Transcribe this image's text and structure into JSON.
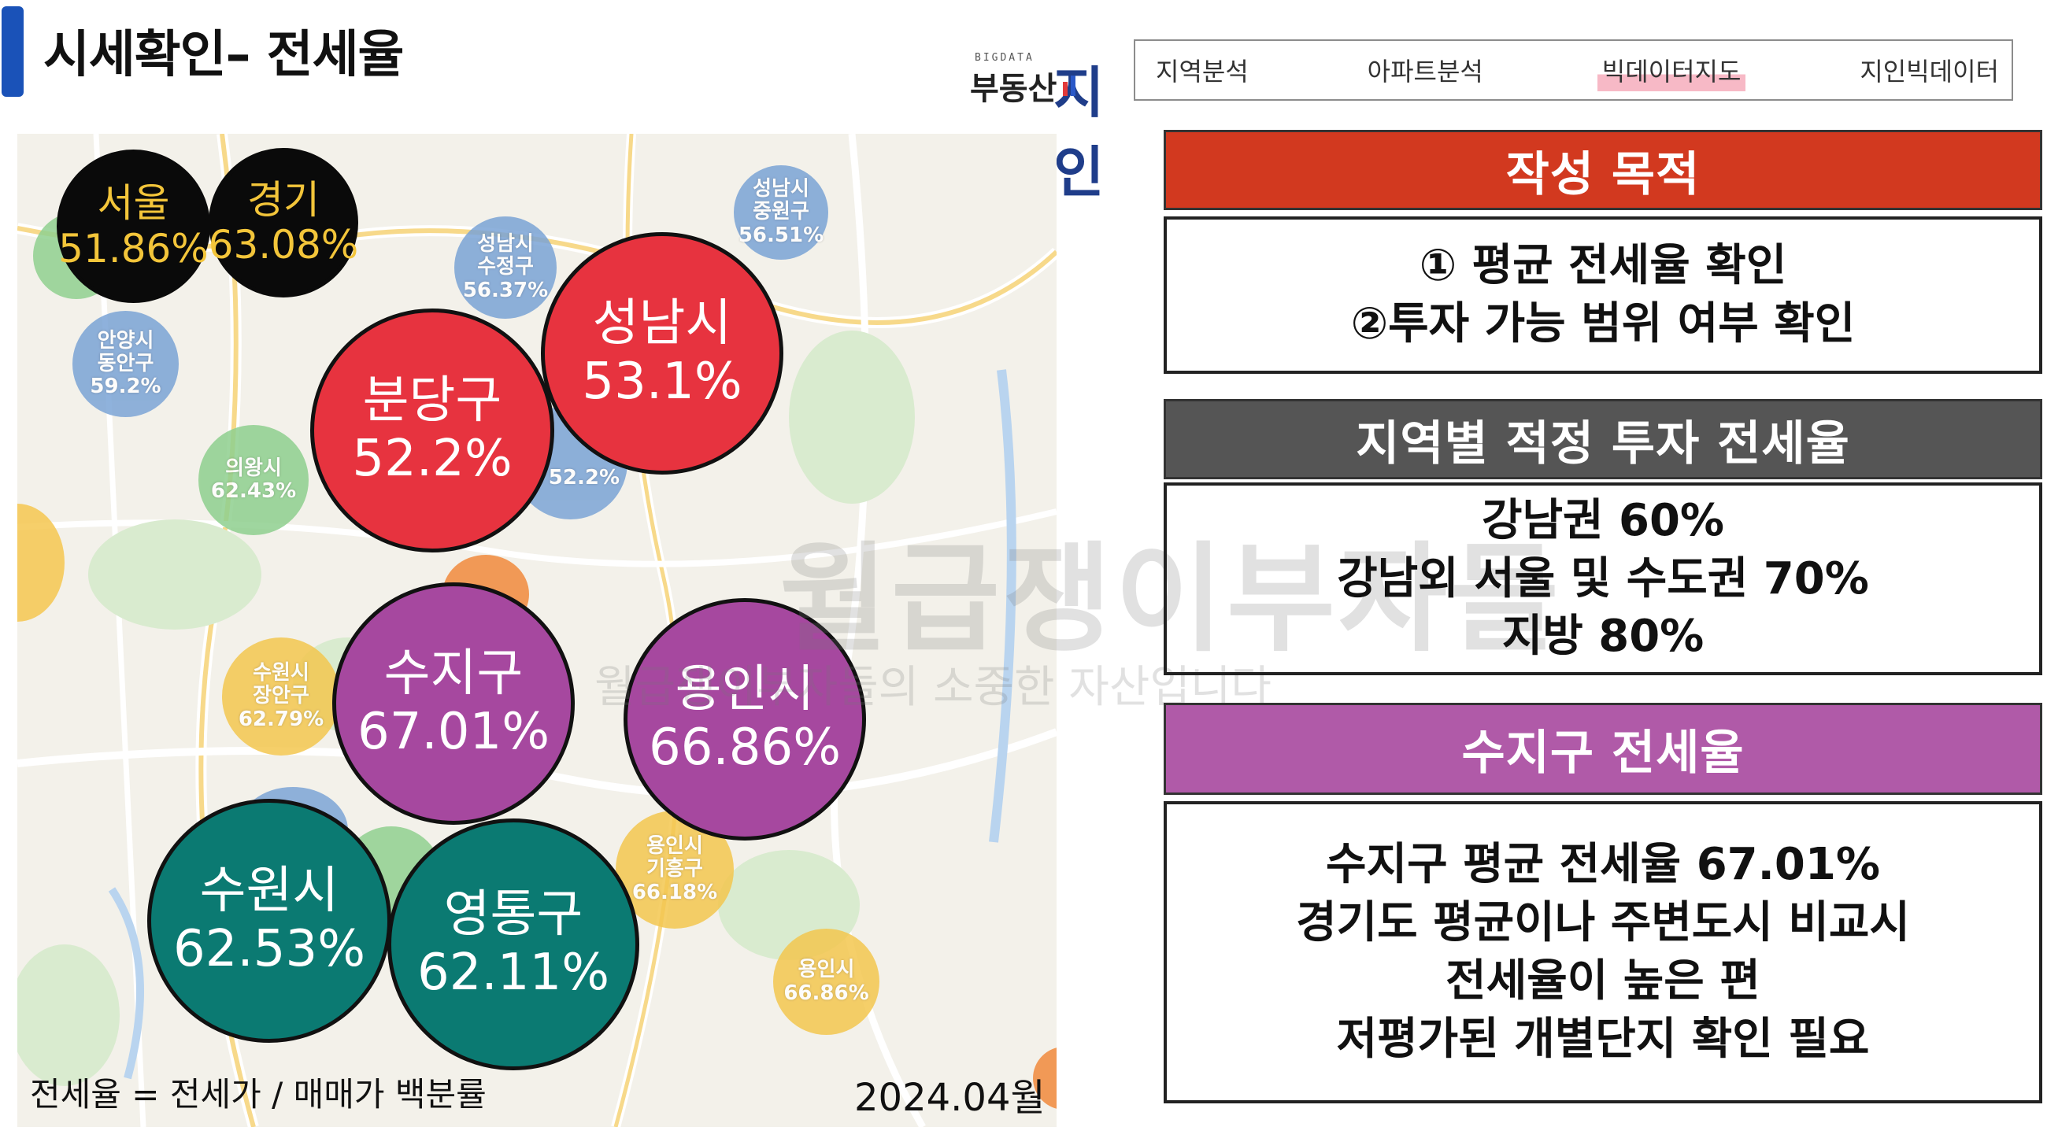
{
  "header": {
    "title": "시세확인– 전세율"
  },
  "logo": {
    "small_text": "BIGDATA",
    "main_text": "부동산",
    "brand_text": "지인"
  },
  "nav": {
    "items": [
      {
        "label": "지역분석",
        "active": false
      },
      {
        "label": "아파트분석",
        "active": false
      },
      {
        "label": "빅데이터지도",
        "active": true
      },
      {
        "label": "지인빅데이터",
        "active": false
      }
    ]
  },
  "map": {
    "small_pins": [
      {
        "name": "성남시\n중원구",
        "value": "56.51%",
        "color": "blue"
      },
      {
        "name": "성남시\n수정구",
        "value": "56.37%",
        "color": "blue"
      },
      {
        "name": "안양시\n동안구",
        "value": "59.2%",
        "color": "blue"
      },
      {
        "name": "의왕시",
        "value": "62.43%",
        "color": "green"
      },
      {
        "name": "",
        "value": "52.2%",
        "color": "blue"
      },
      {
        "name": "수원시\n장안구",
        "value": "62.79%",
        "color": "yellow"
      },
      {
        "name": "용인시\n기흥구",
        "value": "66.18%",
        "color": "yellow"
      },
      {
        "name": "용인시",
        "value": "66.86%",
        "color": "yellow"
      }
    ],
    "bubbles": [
      {
        "name": "서울",
        "value": "51.86%",
        "color": "black"
      },
      {
        "name": "경기",
        "value": "63.08%",
        "color": "black"
      },
      {
        "name": "분당구",
        "value": "52.2%",
        "color": "red"
      },
      {
        "name": "성남시",
        "value": "53.1%",
        "color": "red"
      },
      {
        "name": "수지구",
        "value": "67.01%",
        "color": "purple"
      },
      {
        "name": "용인시",
        "value": "66.86%",
        "color": "purple"
      },
      {
        "name": "수원시",
        "value": "62.53%",
        "color": "teal"
      },
      {
        "name": "영통구",
        "value": "62.11%",
        "color": "teal"
      }
    ],
    "watermark_main": "월급쟁이부자들",
    "watermark_sub": "월급쟁이부자들의 소중한 자산입니다",
    "formula": "전세율 = 전세가 / 매매가 백분률",
    "date": "2024.04월"
  },
  "panels": {
    "purpose": {
      "title": "작성 목적",
      "lines": [
        "① 평균 전세율 확인",
        "②투자 가능 범위 여부 확인"
      ]
    },
    "investment": {
      "title": "지역별 적정 투자 전세율",
      "lines": [
        "강남권 60%",
        "강남외 서울 및 수도권 70%",
        "지방 80%"
      ]
    },
    "suji": {
      "title": "수지구 전세율",
      "lines": [
        "수지구 평균 전세율 67.01%",
        "경기도 평균이나 주변도시 비교시",
        "전세율이 높은 편",
        "저평가된  개별단지 확인 필요"
      ]
    }
  }
}
